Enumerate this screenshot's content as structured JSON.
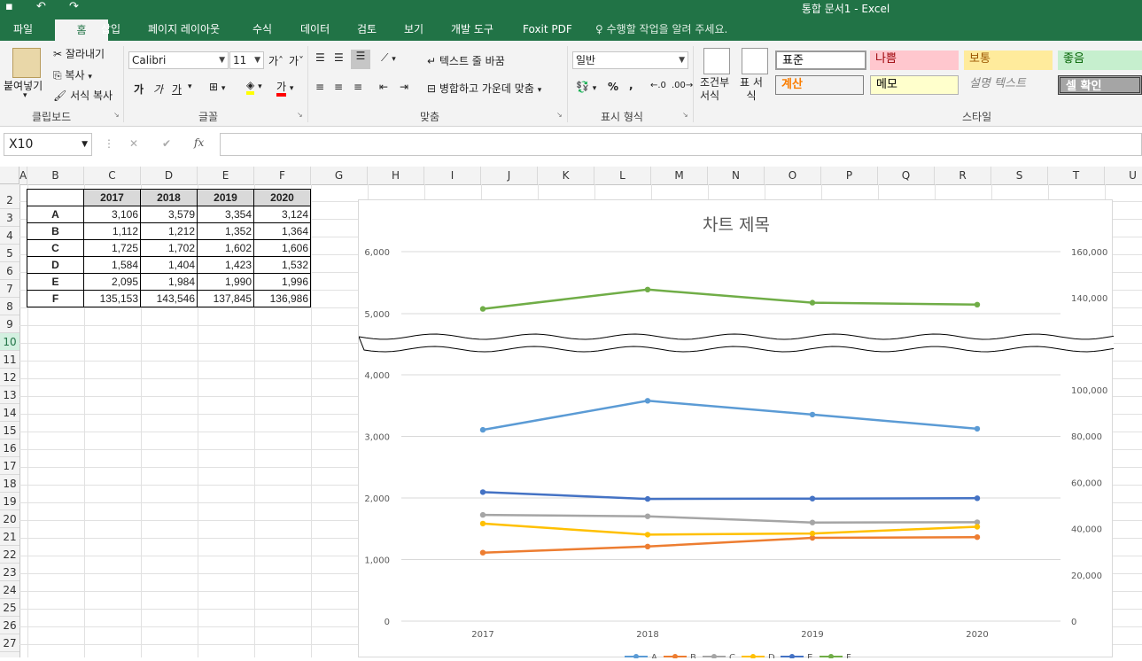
{
  "window": {
    "title": "통합 문서1 - Excel"
  },
  "tabs": [
    "파일",
    "홈",
    "삽입",
    "페이지 레이아웃",
    "수식",
    "데이터",
    "검토",
    "보기",
    "개발 도구",
    "Foxit PDF"
  ],
  "active_tab": "홈",
  "tell_me": "수행할 작업을 알려 주세요.",
  "ribbon": {
    "clipboard": {
      "paste": "붙여넣기",
      "cut": "잘라내기",
      "copy": "복사",
      "format_painter": "서식 복사",
      "label": "클립보드"
    },
    "font": {
      "name": "Calibri",
      "size": "11",
      "label": "글꼴",
      "bold": "가",
      "italic": "가",
      "underline": "가",
      "font_color": "가"
    },
    "alignment": {
      "wrap": "텍스트 줄 바꿈",
      "merge": "병합하고 가운데 맞춤",
      "label": "맞춤"
    },
    "number": {
      "format": "일반",
      "percent": "%",
      "comma": ",",
      "label": "표시 형식"
    },
    "styles": {
      "conditional": "조건부 서식",
      "table": "표 서식",
      "label": "스타일",
      "cells": [
        "표준",
        "나쁨",
        "보통",
        "좋음",
        "계산",
        "메모",
        "설명 텍스트",
        "셀 확인"
      ]
    }
  },
  "formula_bar": {
    "name_box": "X10",
    "cancel": "✕",
    "enter": "✔",
    "fx": "fx",
    "formula": ""
  },
  "columns": [
    "A",
    "B",
    "C",
    "D",
    "E",
    "F",
    "G",
    "H",
    "I",
    "J",
    "K",
    "L",
    "M",
    "N",
    "O",
    "P",
    "Q",
    "R",
    "S",
    "T",
    "U"
  ],
  "rows": [
    "2",
    "3",
    "4",
    "5",
    "6",
    "7",
    "8",
    "9",
    "10",
    "11",
    "12",
    "13",
    "14",
    "15",
    "16",
    "17",
    "18",
    "19",
    "20",
    "21",
    "22",
    "23",
    "24",
    "25",
    "26",
    "27"
  ],
  "active_row": "10",
  "table": {
    "headers": [
      "2017",
      "2018",
      "2019",
      "2020"
    ],
    "rows": [
      {
        "label": "A",
        "values": [
          "3,106",
          "3,579",
          "3,354",
          "3,124"
        ]
      },
      {
        "label": "B",
        "values": [
          "1,112",
          "1,212",
          "1,352",
          "1,364"
        ]
      },
      {
        "label": "C",
        "values": [
          "1,725",
          "1,702",
          "1,602",
          "1,606"
        ]
      },
      {
        "label": "D",
        "values": [
          "1,584",
          "1,404",
          "1,423",
          "1,532"
        ]
      },
      {
        "label": "E",
        "values": [
          "2,095",
          "1,984",
          "1,990",
          "1,996"
        ]
      },
      {
        "label": "F",
        "values": [
          "135,153",
          "143,546",
          "137,845",
          "136,986"
        ]
      }
    ]
  },
  "chart_data": {
    "type": "line",
    "title": "차트 제목",
    "categories": [
      "2017",
      "2018",
      "2019",
      "2020"
    ],
    "y_left_ticks": [
      "0",
      "1,000",
      "2,000",
      "3,000",
      "4,000",
      "5,000",
      "6,000"
    ],
    "y_right_ticks": [
      "0",
      "20,000",
      "40,000",
      "60,000",
      "80,000",
      "100,000",
      "140,000",
      "160,000"
    ],
    "axis_break": true,
    "legend_position": "bottom",
    "series": [
      {
        "name": "A",
        "color": "#5b9bd5",
        "values": [
          3106,
          3579,
          3354,
          3124
        ]
      },
      {
        "name": "B",
        "color": "#ed7d31",
        "values": [
          1112,
          1212,
          1352,
          1364
        ]
      },
      {
        "name": "C",
        "color": "#a5a5a5",
        "values": [
          1725,
          1702,
          1602,
          1606
        ]
      },
      {
        "name": "D",
        "color": "#ffc000",
        "values": [
          1584,
          1404,
          1423,
          1532
        ]
      },
      {
        "name": "E",
        "color": "#4472c4",
        "values": [
          2095,
          1984,
          1990,
          1996
        ]
      },
      {
        "name": "F",
        "color": "#70ad47",
        "values": [
          135153,
          143546,
          137845,
          136986
        ]
      }
    ]
  }
}
